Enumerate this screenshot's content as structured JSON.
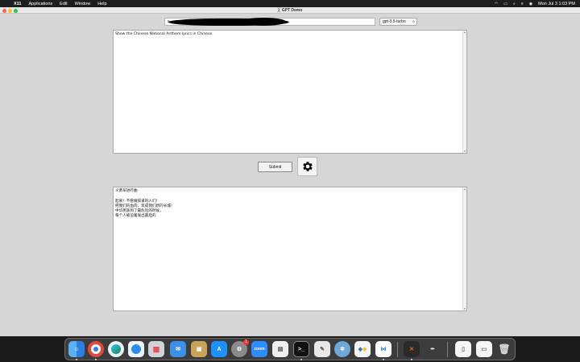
{
  "menubar": {
    "app": "X11",
    "items": [
      "Applications",
      "Edit",
      "Window",
      "Help"
    ],
    "clock": "Mon Jul 3  1:03 PM"
  },
  "window": {
    "title": "GPT Demo"
  },
  "api_key": {
    "value": "s"
  },
  "model": {
    "selected": "gpt-3.5-turbo"
  },
  "prompt": {
    "text": "Show the Chinese National Anthem lyrics in Chinese"
  },
  "submit": {
    "label": "Submit"
  },
  "response": {
    "text": "义勇军进行曲\n\n起来！不愿做奴隶的人们！\n把我们的血肉，筑成我们新的长城！\n中华民族到了最危险的时候，\n每个人被迫着发出最后的"
  },
  "dock": {
    "zoom_label": "zoom",
    "badge": "1",
    "icons": [
      "finder-icon",
      "chrome-icon",
      "edge-icon",
      "safari-icon",
      "launchpad-icon",
      "mail-icon",
      "notes-icon",
      "app-store-icon",
      "system-settings-icon",
      "zoom-icon",
      "preview-icon",
      "terminal-icon",
      "script-editor-icon",
      "keychain-icon",
      "python-icon",
      "vscode-icon",
      "xquartz-icon",
      "pen-icon",
      "file-icon",
      "document-icon",
      "trash-icon"
    ]
  }
}
